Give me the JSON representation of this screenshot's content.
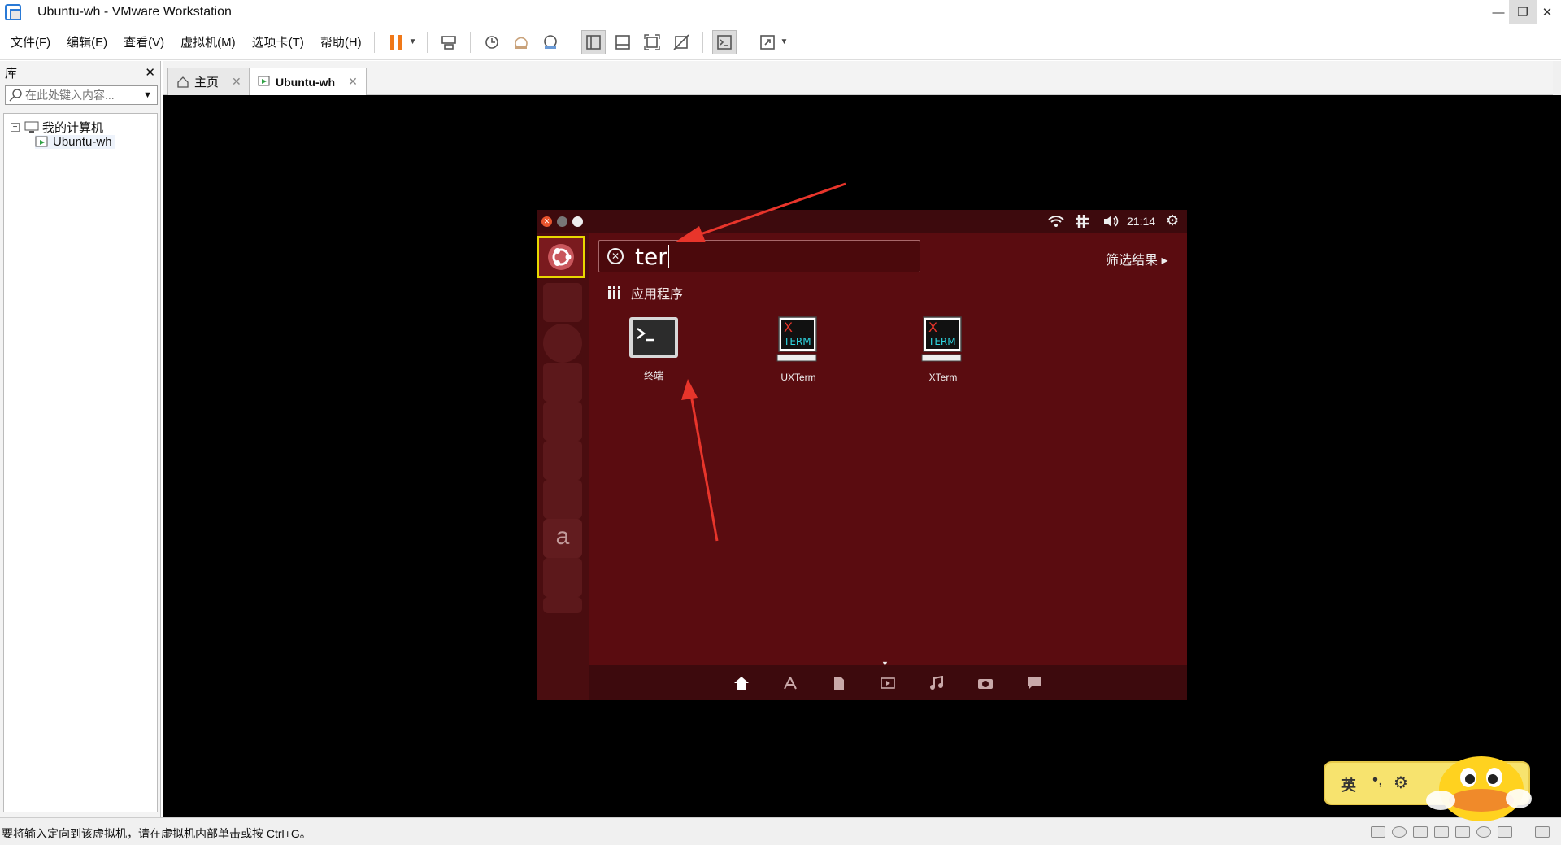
{
  "window": {
    "title": "Ubuntu-wh - VMware Workstation",
    "min": "—",
    "restore": "❐",
    "close": "✕"
  },
  "menu": [
    "文件(F)",
    "编辑(E)",
    "查看(V)",
    "虚拟机(M)",
    "选项卡(T)",
    "帮助(H)"
  ],
  "library": {
    "title": "库",
    "close": "✕",
    "search_placeholder": "在此处键入内容...",
    "tree_root": "我的计算机",
    "tree_vm": "Ubuntu-wh"
  },
  "tabs": [
    {
      "label": "主页",
      "close": "✕"
    },
    {
      "label": "Ubuntu-wh",
      "close": "✕"
    }
  ],
  "ubuntu": {
    "clock": "21:14",
    "search_query": "ter",
    "filter_results": "筛选结果 ▸",
    "section": "应用程序",
    "apps": [
      {
        "label": "终端"
      },
      {
        "label": "UXTerm"
      },
      {
        "label": "XTerm"
      }
    ],
    "xterm_top": "X",
    "xterm_bottom": "TERM"
  },
  "statusbar": {
    "text": "要将输入定向到该虚拟机，请在虚拟机内部单击或按 Ctrl+G。"
  },
  "ime": {
    "label": "英",
    "punct": "•,",
    "gear": "⚙"
  },
  "colors": {
    "accent_red": "#e8352b",
    "ubuntu_bg": "#5a0c10",
    "highlight_yellow": "#e8d800",
    "pause_orange": "#f07818"
  }
}
